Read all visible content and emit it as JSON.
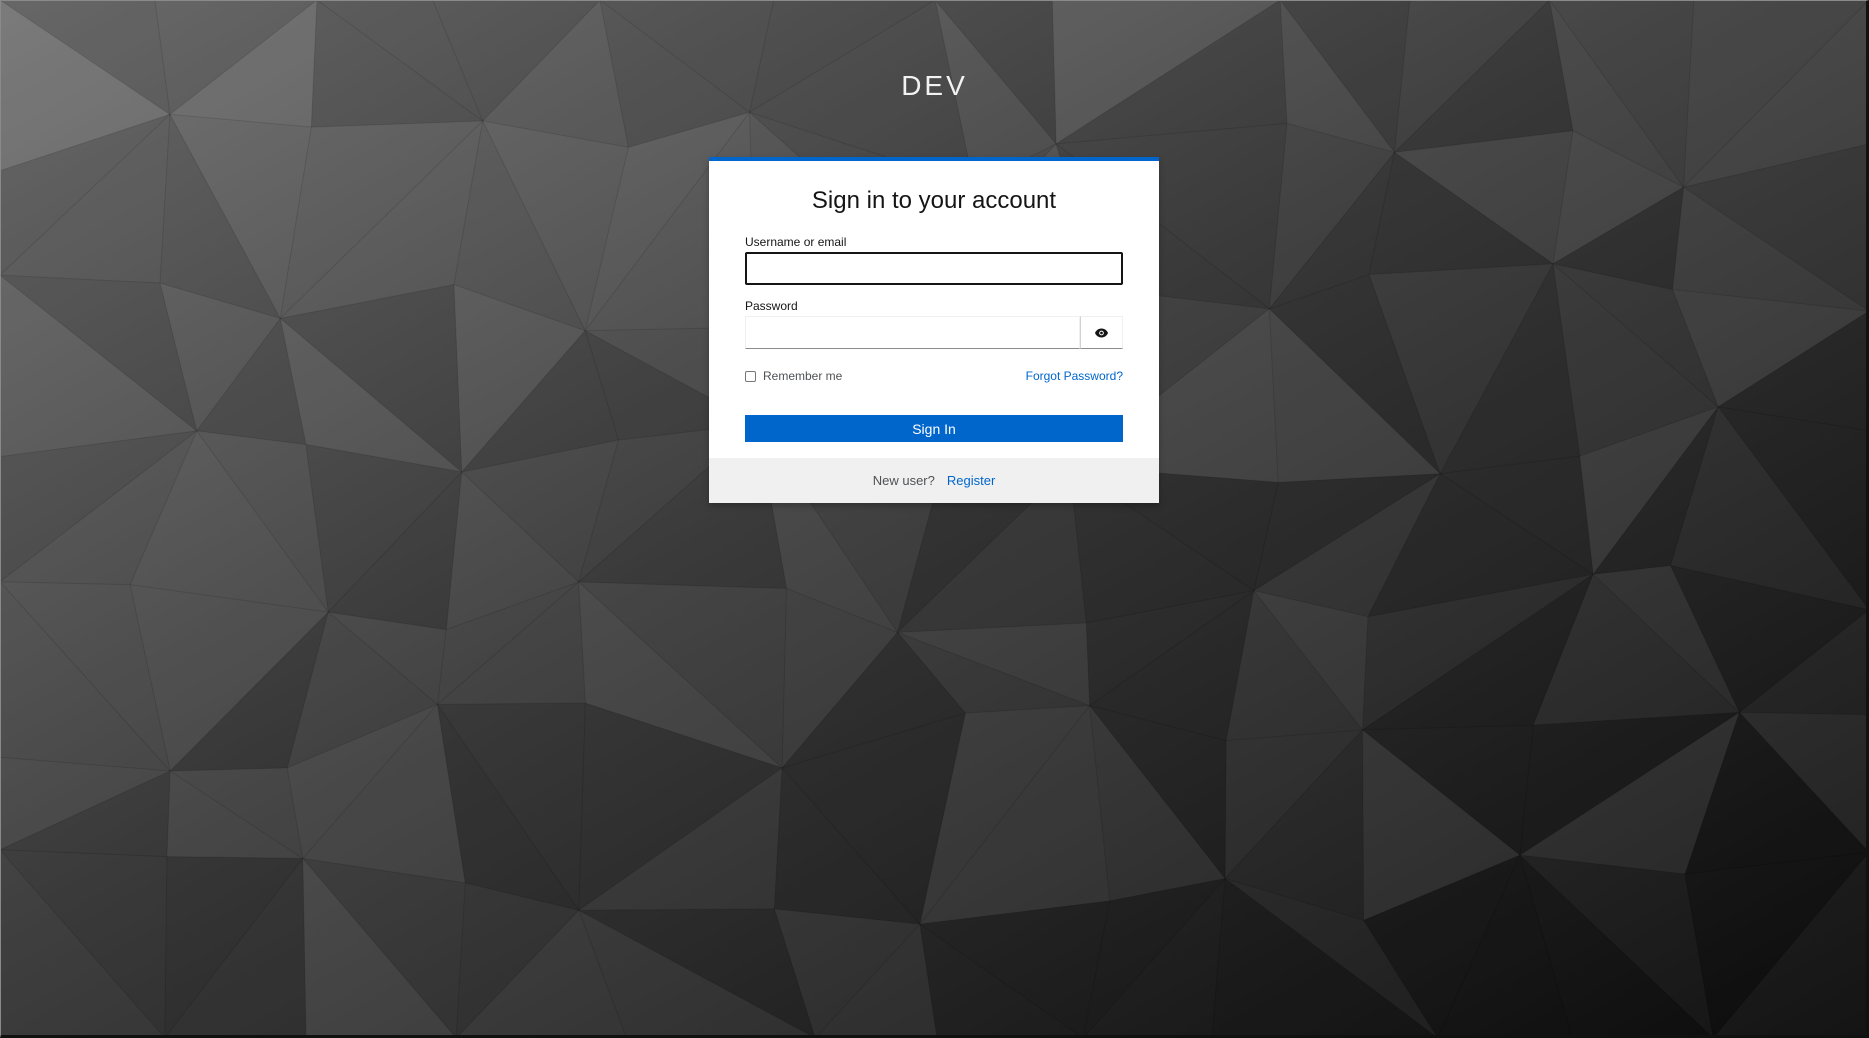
{
  "realm": {
    "title": "DEV"
  },
  "login": {
    "heading": "Sign in to your account",
    "username_label": "Username or email",
    "username_value": "",
    "password_label": "Password",
    "password_value": "",
    "show_password_icon": "eye-icon",
    "remember_label": "Remember me",
    "remember_checked": false,
    "forgot_label": "Forgot Password?",
    "submit_label": "Sign In"
  },
  "footer": {
    "new_user_text": "New user?",
    "register_label": "Register"
  },
  "colors": {
    "accent": "#0066cc",
    "card_bg": "#ffffff",
    "footer_bg": "#f0f0f0",
    "page_bg_light": "#6f6f6f",
    "page_bg_dark": "#0c0c0c"
  }
}
